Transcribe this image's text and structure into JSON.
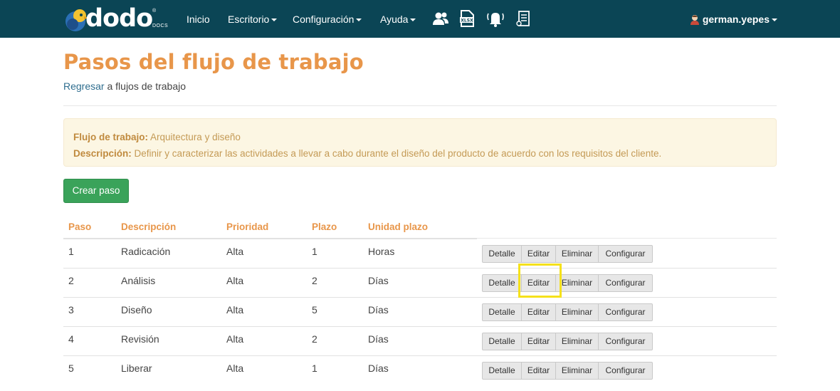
{
  "nav": {
    "brand": "dodo",
    "brand_sub": "DOCS",
    "brand_reg": "®",
    "items": [
      {
        "label": "Inicio",
        "dropdown": false
      },
      {
        "label": "Escritorio",
        "dropdown": true
      },
      {
        "label": "Configuración",
        "dropdown": true
      },
      {
        "label": "Ayuda",
        "dropdown": true
      }
    ],
    "icons": [
      "users-icon",
      "xlsx-file-icon",
      "bell-icon",
      "document-list-icon"
    ],
    "user": "german.yepes"
  },
  "page": {
    "title": "Pasos del flujo de trabajo",
    "back_link": "Regresar",
    "back_text": "a flujos de trabajo"
  },
  "info": {
    "workflow_label": "Flujo de trabajo:",
    "workflow_value": "Arquitectura y diseño",
    "description_label": "Descripción:",
    "description_value": "Definir y caracterizar las actividades a llevar a cabo durante el diseño del producto de acuerdo con los requisitos del cliente."
  },
  "create_button": "Crear paso",
  "table": {
    "headers": [
      "Paso",
      "Descripción",
      "Prioridad",
      "Plazo",
      "Unidad plazo"
    ],
    "actions": [
      "Detalle",
      "Editar",
      "Eliminar",
      "Configurar"
    ],
    "rows": [
      {
        "paso": "1",
        "descripcion": "Radicación",
        "prioridad": "Alta",
        "plazo": "1",
        "unidad": "Horas"
      },
      {
        "paso": "2",
        "descripcion": "Análisis",
        "prioridad": "Alta",
        "plazo": "2",
        "unidad": "Días"
      },
      {
        "paso": "3",
        "descripcion": "Diseño",
        "prioridad": "Alta",
        "plazo": "5",
        "unidad": "Días"
      },
      {
        "paso": "4",
        "descripcion": "Revisión",
        "prioridad": "Alta",
        "plazo": "2",
        "unidad": "Días"
      },
      {
        "paso": "5",
        "descripcion": "Liberar",
        "prioridad": "Alta",
        "plazo": "1",
        "unidad": "Días"
      }
    ]
  },
  "colors": {
    "navbar": "#0b4555",
    "accent": "#e8964a",
    "success": "#3aa35a",
    "highlight": "#f5e11b"
  }
}
